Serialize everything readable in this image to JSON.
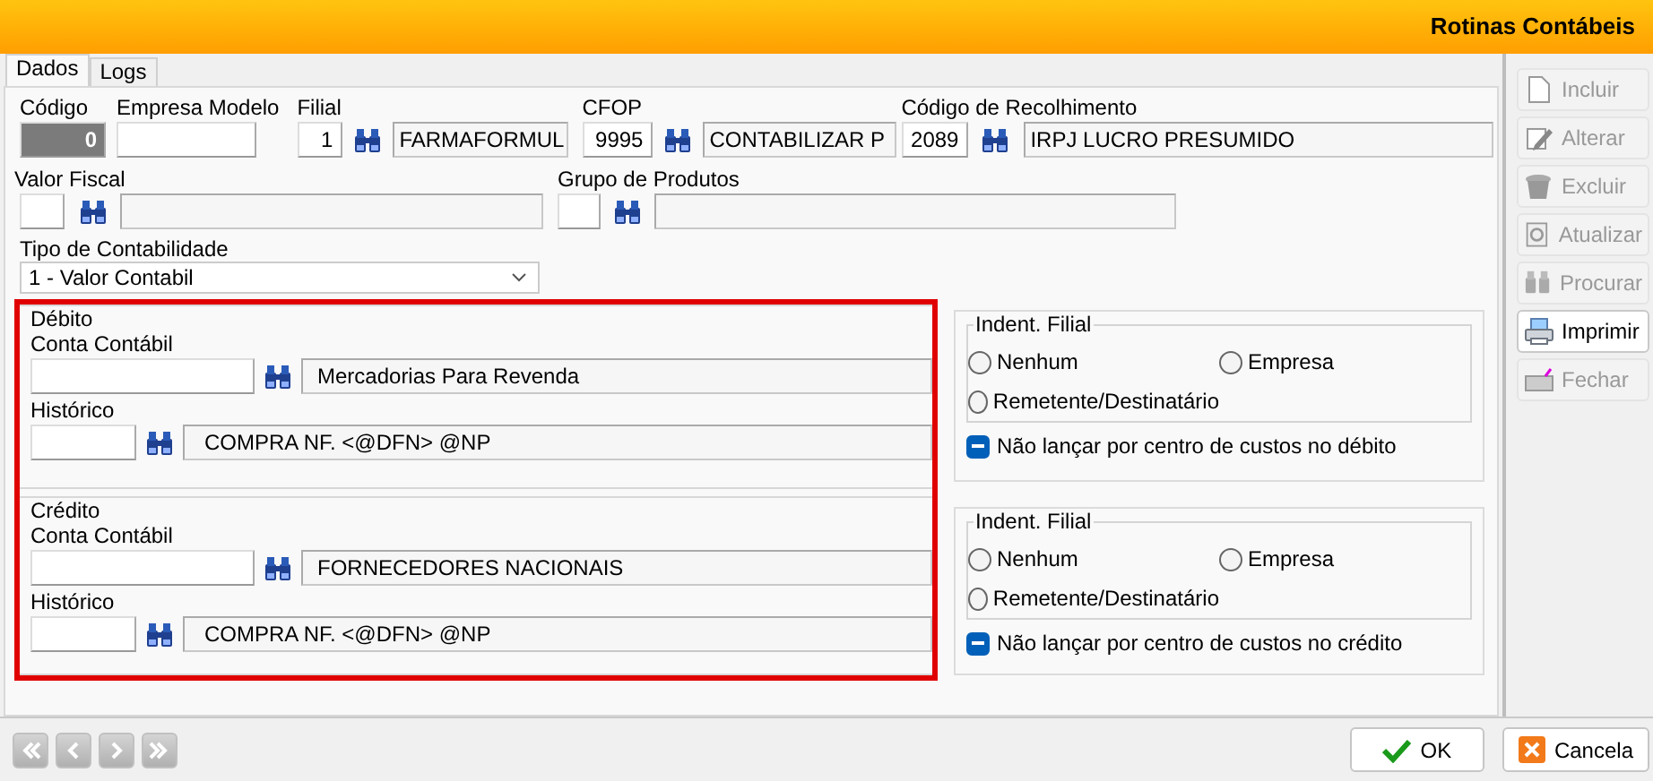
{
  "window": {
    "title": "Rotinas Contábeis"
  },
  "tabs": [
    {
      "label": "Dados",
      "selected": true
    },
    {
      "label": "Logs",
      "selected": false
    }
  ],
  "header_rows": [
    [
      {
        "kind": "locked",
        "label": "Código",
        "value": "0"
      },
      {
        "kind": "text",
        "label": "Empresa Modelo"
      },
      {
        "kind": "lookup",
        "label": "Filial",
        "code": "1",
        "description": "FARMAFORMUL"
      },
      {
        "kind": "lookup",
        "label": "CFOP",
        "code": "9995",
        "description": "CONTABILIZAR P"
      },
      {
        "kind": "lookup",
        "label": "Código de Recolhimento",
        "code": "2089",
        "description": "IRPJ LUCRO PRESUMIDO"
      }
    ],
    [
      {
        "kind": "lookup",
        "label": "Valor Fiscal"
      },
      {
        "kind": "lookup",
        "label": "Grupo de Produtos"
      }
    ]
  ],
  "accounting_type": {
    "label": "Tipo de Contabilidade",
    "value": "1 - Valor Contabil"
  },
  "sections": [
    {
      "title": "Débito",
      "account": {
        "label": "Conta Contábil",
        "description": "Mercadorias Para Revenda"
      },
      "history": {
        "label": "Histórico",
        "description": "COMPRA NF. <@DFN> @NP"
      },
      "branch": {
        "title": "Indent. Filial",
        "options": [
          {
            "label": "Nenhum",
            "selected": false
          },
          {
            "label": "Empresa",
            "selected": false
          },
          {
            "label": "Remetente/Destinatário",
            "selected": false
          }
        ]
      },
      "cost_center": {
        "label": "Não lançar por centro de custos no débito",
        "indeterminate": true
      }
    },
    {
      "title": "Crédito",
      "account": {
        "label": "Conta Contábil",
        "description": "FORNECEDORES NACIONAIS"
      },
      "history": {
        "label": "Histórico",
        "description": "COMPRA NF. <@DFN> @NP"
      },
      "branch": {
        "title": "Indent. Filial",
        "options": [
          {
            "label": "Nenhum",
            "selected": false
          },
          {
            "label": "Empresa",
            "selected": false
          },
          {
            "label": "Remetente/Destinatário",
            "selected": false
          }
        ]
      },
      "cost_center": {
        "label": "Não lançar por centro de custos no crédito",
        "indeterminate": true
      }
    }
  ],
  "side_buttons": [
    {
      "label": "Incluir",
      "disabled": true
    },
    {
      "label": "Alterar",
      "disabled": true
    },
    {
      "label": "Excluir",
      "disabled": true
    },
    {
      "label": "Atualizar",
      "disabled": true
    },
    {
      "label": "Procurar",
      "disabled": true
    },
    {
      "label": "Imprimir",
      "disabled": false
    },
    {
      "label": "Fechar",
      "disabled": true
    }
  ],
  "footer_buttons": [
    {
      "kind": "ok",
      "label": "OK"
    },
    {
      "kind": "cancel",
      "label": "Cancela"
    }
  ]
}
